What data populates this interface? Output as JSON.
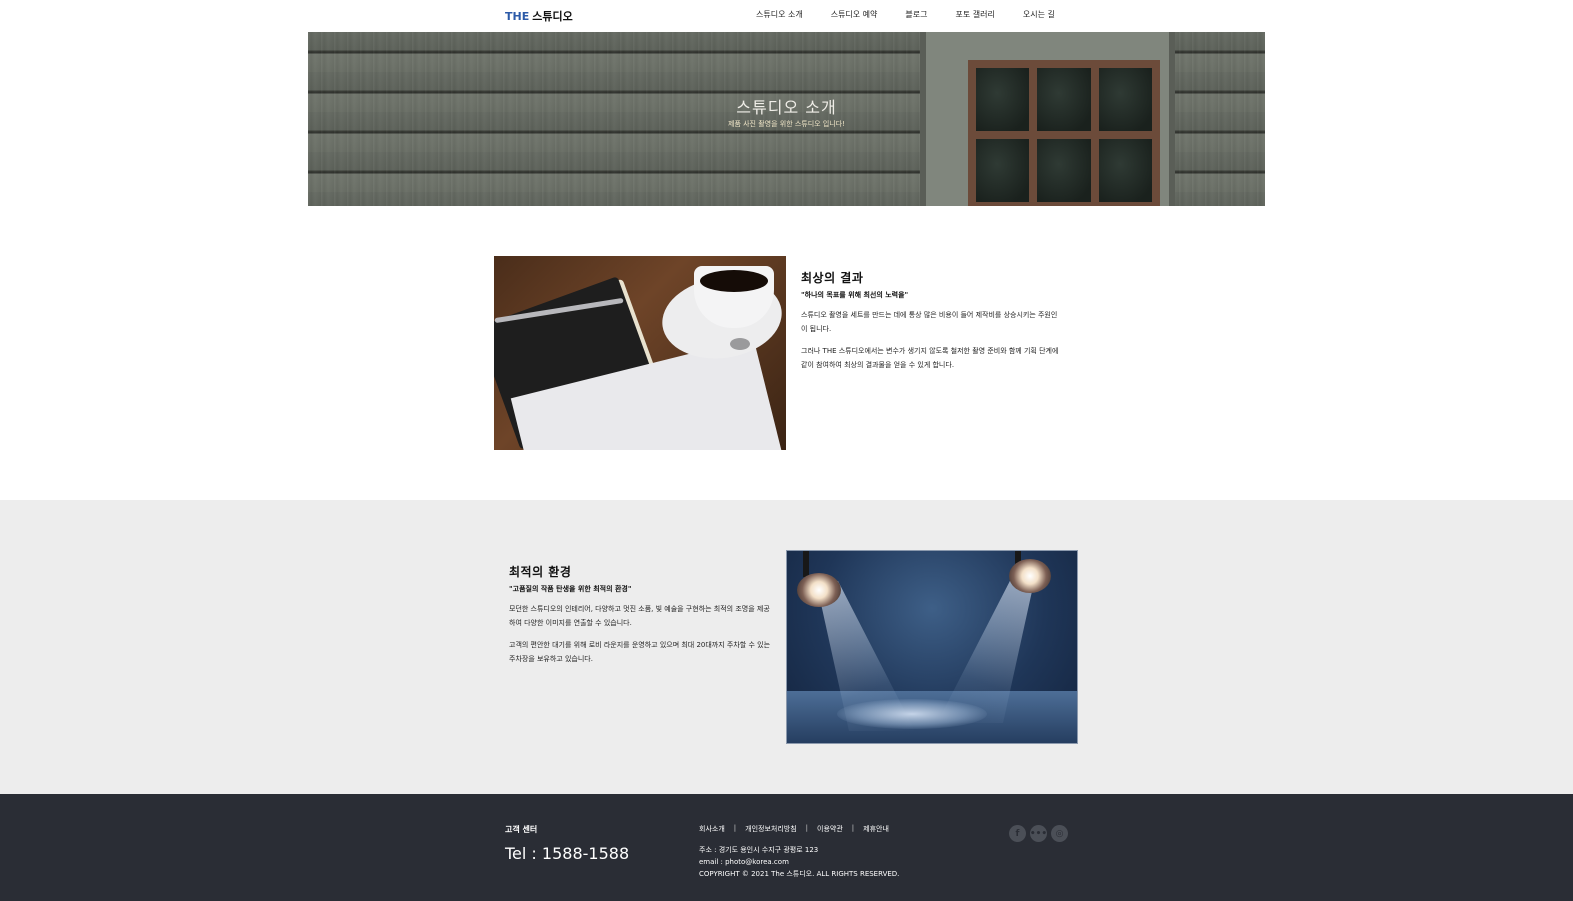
{
  "header": {
    "logo_the": "THE",
    "logo_name": "스튜디오",
    "nav": [
      "스튜디오 소개",
      "스튜디오 예약",
      "블로그",
      "포토 갤러리",
      "오시는 길"
    ]
  },
  "hero": {
    "title": "스튜디오 소개",
    "subtitle": "제품 사진 촬영을 위한 스튜디오 입니다!"
  },
  "section1": {
    "title": "최상의 결과",
    "subtitle": "\"하나의 목표를 위해 최선의 노력을\"",
    "p1": "스튜디오 촬영을 세트를 만드는 데에 통상 많은 비용이 들어 제작비를 상승시키는 주원인이 됩니다.",
    "p2": "그러나 THE 스튜디오에서는 변수가 생기지 않도록 철저한 촬영 준비와 함께 기획 단계에 같이 참여하여 최상의 결과물을 얻을 수 있게 합니다."
  },
  "section2": {
    "title": "최적의 환경",
    "subtitle": "\"고품질의 작품 탄생을 위한 최적의 환경\"",
    "p1": "모던한 스튜디오의 인테리어, 다양하고 멋진 소품, 빛 예술을 구현하는 최적의 조명을 제공하여 다양한 이미지를 연출할 수 있습니다.",
    "p2": "고객의 편안한 대기를 위해 로비 라운지를 운영하고 있으며 최대 20대까지 주차할 수 있는 주차장을 보유하고 있습니다."
  },
  "footer": {
    "cs_title": "고객 센터",
    "tel": "Tel : 1588-1588",
    "links": [
      "회사소개",
      "개인정보처리방침",
      "이용약관",
      "제휴안내"
    ],
    "separator": "|",
    "address": "주소 : 경기도 용인시 수지구 광평로 123",
    "email": "email : photo@korea.com",
    "copyright": "COPYRIGHT © 2021 The 스튜디오. ALL RIGHTS RESERVED.",
    "social_icons": [
      "facebook-icon",
      "blog-icon",
      "instagram-icon"
    ]
  }
}
